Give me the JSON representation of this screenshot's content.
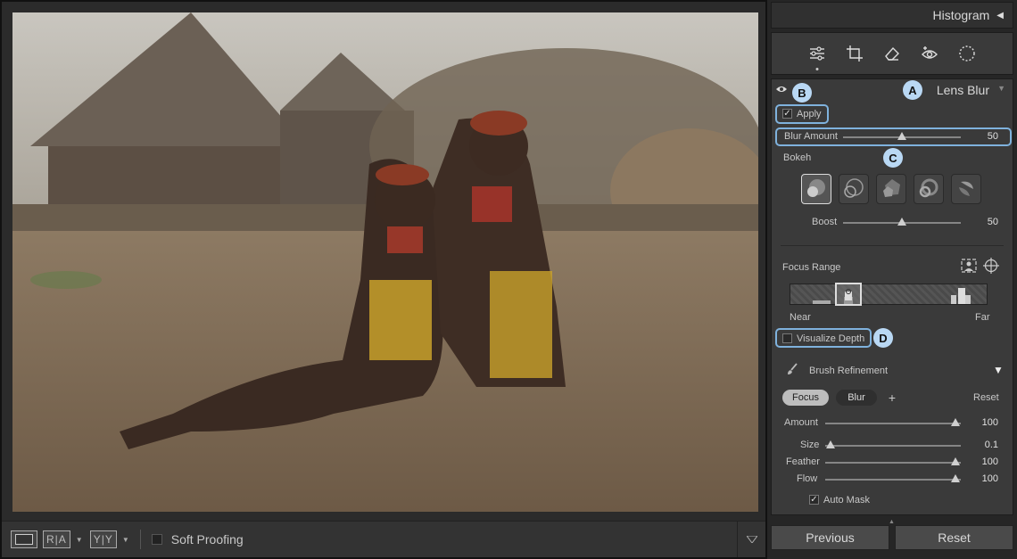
{
  "viewer": {
    "view_buttons": {
      "before_after_1": "R|A",
      "before_after_2": "Y|Y"
    },
    "soft_proofing_label": "Soft Proofing"
  },
  "panel": {
    "histogram_title": "Histogram",
    "histogram_toggle": "◀",
    "tools": [
      "edit-sliders-icon",
      "crop-icon",
      "eraser-icon",
      "red-eye-icon",
      "masking-icon"
    ],
    "lens_blur": {
      "title": "Lens Blur",
      "apply_label": "Apply",
      "apply_checked": true,
      "blur_amount": {
        "label": "Blur Amount",
        "value": "50",
        "fraction": 0.5
      },
      "bokeh_label": "Bokeh",
      "bokeh_shapes": [
        "circle",
        "bubble",
        "5-blade",
        "ring",
        "cat-eye"
      ],
      "bokeh_selected": 0,
      "boost": {
        "label": "Boost",
        "value": "50",
        "fraction": 0.5
      },
      "focus_range_label": "Focus Range",
      "focus_near": "Near",
      "focus_far": "Far",
      "visualize_depth_label": "Visualize Depth",
      "brush_refinement_label": "Brush Refinement",
      "brush_toggle": "▼",
      "focus_btn": "Focus",
      "blur_btn": "Blur",
      "add_btn": "+",
      "reset_link": "Reset",
      "amount": {
        "label": "Amount",
        "value": "100",
        "fraction": 1.0
      },
      "size": {
        "label": "Size",
        "value": "0.1",
        "fraction": 0.0
      },
      "feather": {
        "label": "Feather",
        "value": "100",
        "fraction": 1.0
      },
      "flow": {
        "label": "Flow",
        "value": "100",
        "fraction": 1.0
      },
      "auto_mask_label": "Auto Mask",
      "auto_mask_checked": true
    },
    "callouts": [
      "A",
      "B",
      "C",
      "D"
    ],
    "footer": {
      "previous": "Previous",
      "reset": "Reset"
    }
  },
  "colors": {
    "callout": "#7fb2dd",
    "callout_badge": "#b9d8f4",
    "panel_bg": "#3a3a3a"
  }
}
